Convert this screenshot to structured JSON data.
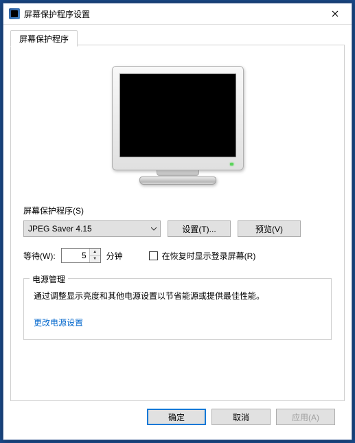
{
  "window": {
    "title": "屏幕保护程序设置"
  },
  "tab": {
    "label": "屏幕保护程序"
  },
  "screensaver": {
    "section_label": "屏幕保护程序(S)",
    "selected": "JPEG Saver 4.15",
    "settings_btn": "设置(T)...",
    "preview_btn": "预览(V)"
  },
  "wait": {
    "label": "等待(W):",
    "value": "5",
    "unit": "分钟"
  },
  "resume": {
    "label": "在恢复时显示登录屏幕(R)",
    "checked": false
  },
  "power": {
    "legend": "电源管理",
    "desc": "通过调整显示亮度和其他电源设置以节省能源或提供最佳性能。",
    "link": "更改电源设置"
  },
  "buttons": {
    "ok": "确定",
    "cancel": "取消",
    "apply": "应用(A)"
  }
}
